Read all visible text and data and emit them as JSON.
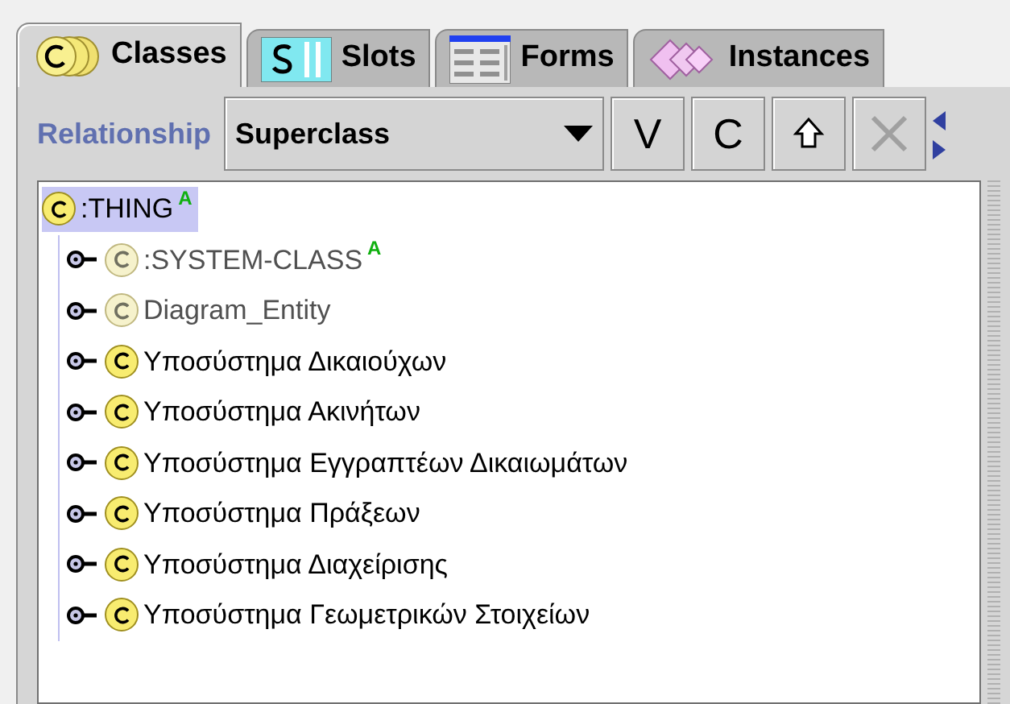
{
  "tabs": [
    {
      "label": "Classes",
      "kind": "classes",
      "selected": true
    },
    {
      "label": "Slots",
      "kind": "slots",
      "selected": false
    },
    {
      "label": "Forms",
      "kind": "forms",
      "selected": false
    },
    {
      "label": "Instances",
      "kind": "instances",
      "selected": false
    }
  ],
  "toolbar": {
    "label": "Relationship",
    "dropdown": "Superclass",
    "buttons": [
      {
        "label": "V",
        "kind": "text",
        "disabled": false
      },
      {
        "label": "C",
        "kind": "text",
        "disabled": false
      },
      {
        "kind": "up",
        "disabled": false
      },
      {
        "kind": "delete",
        "disabled": true
      }
    ]
  },
  "tree": {
    "root": {
      "label": ":THING",
      "badge": "A",
      "selected": true,
      "dimmed": false,
      "children": [
        {
          "label": ":SYSTEM-CLASS",
          "badge": "A",
          "dimmed": true,
          "selected": false
        },
        {
          "label": "Diagram_Entity",
          "dimmed": true,
          "selected": false
        },
        {
          "label": "Υποσύστημα Δικαιούχων",
          "dimmed": false,
          "selected": false
        },
        {
          "label": "Υποσύστημα Ακινήτων",
          "dimmed": false,
          "selected": false
        },
        {
          "label": "Υποσύστημα Εγγραπτέων Δικαιωμάτων",
          "dimmed": false,
          "selected": false
        },
        {
          "label": "Υποσύστημα Πράξεων",
          "dimmed": false,
          "selected": false
        },
        {
          "label": "Υποσύστημα Διαχείρισης",
          "dimmed": false,
          "selected": false
        },
        {
          "label": "Υποσύστημα Γεωμετρικών Στοιχείων",
          "dimmed": false,
          "selected": false
        }
      ]
    }
  }
}
